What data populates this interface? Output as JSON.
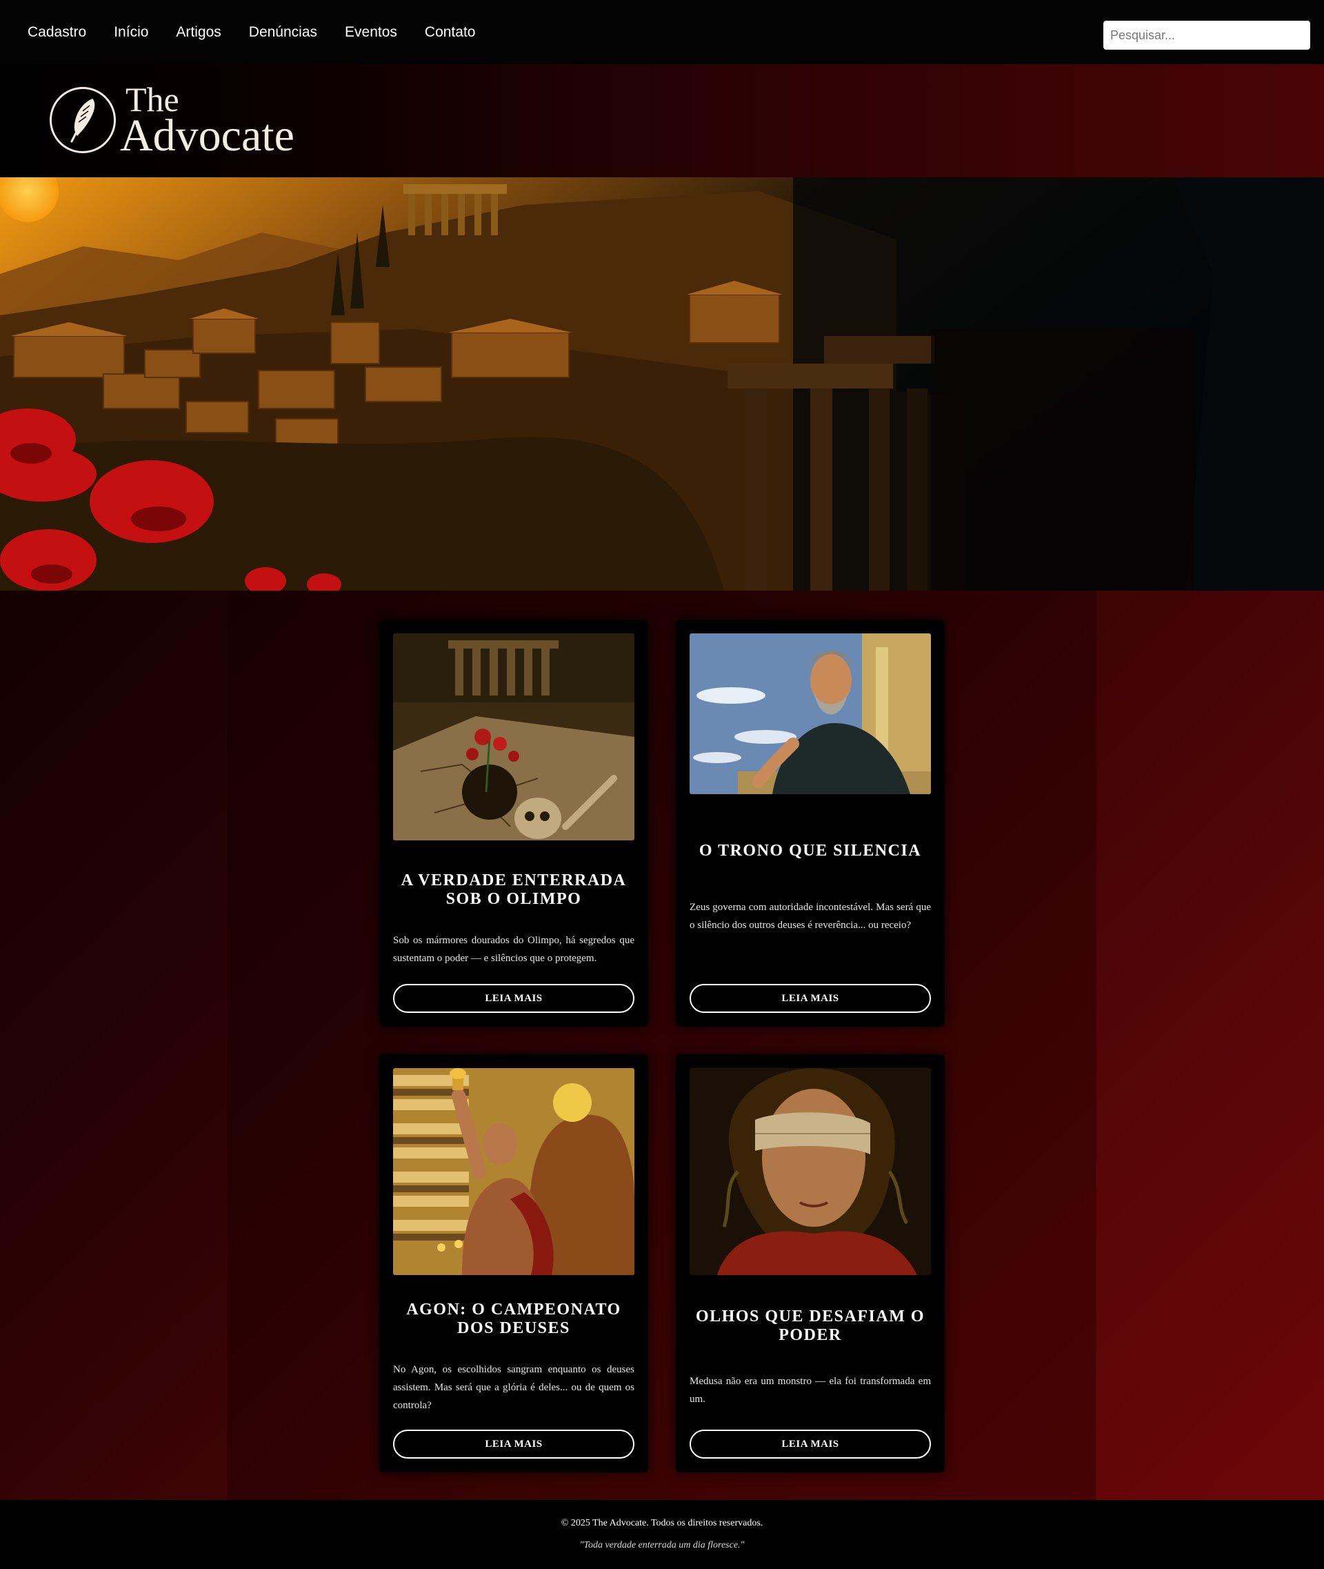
{
  "nav": {
    "items": [
      {
        "label": "Cadastro"
      },
      {
        "label": "Início"
      },
      {
        "label": "Artigos"
      },
      {
        "label": "Denúncias"
      },
      {
        "label": "Eventos"
      },
      {
        "label": "Contato"
      }
    ],
    "search_placeholder": "Pesquisar..."
  },
  "brand": {
    "logo_the": "The",
    "logo_name": "Advocate",
    "logo_icon": "quill-feather-icon"
  },
  "hero": {
    "image": "ancient-greek-city-sunset-with-red-poppies-and-ruined-columns"
  },
  "articles": [
    {
      "title": "A VERDADE ENTERRADA SOB O OLIMPO",
      "excerpt": "Sob os mármores dourados do Olimpo, há segredos que sustentam o poder — e silêncios que o protegem.",
      "button": "LEIA MAIS",
      "image": "cracked-ground-rose-skull-temple-ruins"
    },
    {
      "title": "O TRONO QUE SILENCIA",
      "excerpt": "Zeus governa com autoridade incontestável. Mas será que o silêncio dos outros deuses é reverência... ou receio?",
      "button": "LEIA MAIS",
      "image": "zeus-seated-on-throne"
    },
    {
      "title": "AGON: O CAMPEONATO DOS DEUSES",
      "excerpt": "No Agon, os escolhidos sangram enquanto os deuses assistem. Mas será que a glória é deles... ou de quem os controla?",
      "button": "LEIA MAIS",
      "image": "bloodied-champion-raising-torch-in-arena"
    },
    {
      "title": "OLHOS QUE DESAFIAM O PODER",
      "excerpt": "Medusa não era um monstro — ela foi transformada em um.",
      "button": "LEIA MAIS",
      "image": "blindfolded-medusa-portrait"
    }
  ],
  "footer": {
    "copyright": "© 2025 The Advocate. Todos os direitos reservados.",
    "quote": "\"Toda verdade enterrada um dia floresce.\""
  },
  "colors": {
    "nav_bg": "#030303",
    "page_gradient_dark": "#000000",
    "page_gradient_red": "#6e0608",
    "card_bg": "#000000",
    "text": "#ffffff",
    "logo": "#f3ece0"
  }
}
